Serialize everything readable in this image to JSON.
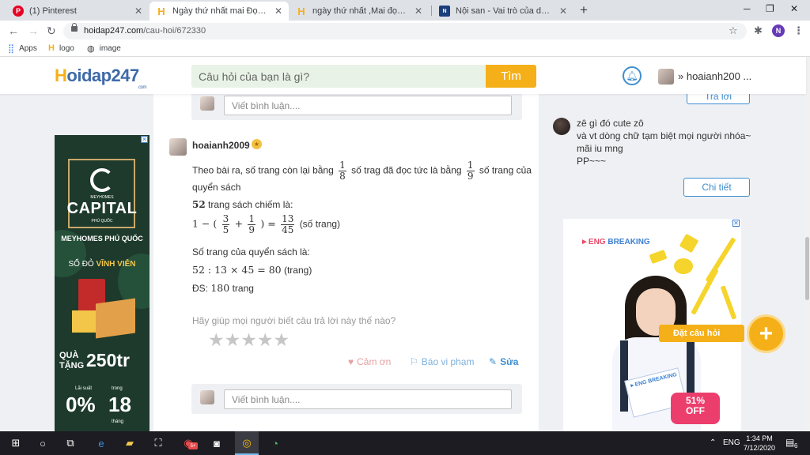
{
  "browser": {
    "tabs": [
      {
        "title": "(1) Pinterest",
        "icon": "pinterest-icon",
        "active": false
      },
      {
        "title": "Ngày thứ nhất mai Đọc được 3/5 số...",
        "icon": "hoidap-icon",
        "active": true
      },
      {
        "title": "ngày thứ nhất ,Mai đọc được 3/5 c...",
        "icon": "hoidap-icon",
        "active": false
      },
      {
        "title": "Nội san - Vai trò của dân ca trong...",
        "icon": "noisan-icon",
        "active": false
      }
    ],
    "url_host": "hoidap247.com",
    "url_path": "/cau-hoi/672330",
    "profile_initial": "N",
    "bookmarks": [
      {
        "label": "Apps",
        "icon": "apps-grid-icon"
      },
      {
        "label": "logo",
        "icon": "hoidap-icon"
      },
      {
        "label": "image",
        "icon": "globe-icon"
      }
    ]
  },
  "site": {
    "logo_h": "H",
    "logo_rest": "oidap247",
    "logo_sub": ".com",
    "search_placeholder": "Câu hỏi của bạn là gì?",
    "search_button": "Tìm",
    "user_name": "hoaianh200 ..."
  },
  "comment_placeholder": "Viết bình luận....",
  "answer": {
    "user": "hoaianh2009",
    "line1_a": "Theo bài ra, số trang còn lại bằng",
    "frac1_num": "1",
    "frac1_den": "8",
    "line1_b": "số trag đã đọc tức là bằng",
    "frac2_num": "1",
    "frac2_den": "9",
    "line1_c": "số trang của",
    "line2": "quyển sách",
    "line3_num": "52",
    "line3_text": "trang sách chiếm là:",
    "line4_a": "1 − (",
    "frac3_num": "3",
    "frac3_den": "5",
    "line4_plus": "+",
    "frac4_num": "1",
    "frac4_den": "9",
    "line4_eq": ") =",
    "frac5_num": "13",
    "frac5_den": "45",
    "line4_unit": "(số trang)",
    "line5": "Số trang của quyển sách là:",
    "line6_expr": "52 : 13 × 45 = 80",
    "line6_unit": "(trang)",
    "line7_label": "ĐS:",
    "line7_num": "180",
    "line7_unit": "trang",
    "help_text": "Hãy giúp mọi người biết câu trả lời này thế nào?",
    "rating": 0,
    "rating_max": 5,
    "thanks_label": "Cảm ơn",
    "report_label": "Báo vi phạm",
    "edit_label": "Sửa"
  },
  "sidebar": {
    "reply_button": "Trả lời",
    "message_lines": [
      "zê gì đó cute zô",
      "và vt dòng chữ tạm biệt mọi người nhóa~",
      "mãi iu mng",
      "PP~~~"
    ],
    "detail_button": "Chi tiết"
  },
  "ads": {
    "right": {
      "brand_prefix": "►ENG",
      "brand_highlight": "BREAKING",
      "book_brand": "►ENG BREAKING",
      "discount_pct": "51%",
      "discount_word": "OFF"
    },
    "left": {
      "top_brand": "MEYHOMES",
      "capital": "CAPITAL",
      "location_small": "PHÚ QUỐC",
      "headline": "MEYHOMES PHÚ QUỐC",
      "sub_a": "SỔ ĐỎ",
      "sub_b": "VĨNH VIỄN",
      "gift_a": "QUÀ",
      "gift_b": "TẶNG",
      "gift_amount": "250tr",
      "rate_label": "Lãi suất",
      "rate_value": "0%",
      "term_label": "trong",
      "term_value": "18",
      "term_unit": "tháng"
    }
  },
  "fab_label": "Đặt câu hỏi",
  "taskbar": {
    "lang": "ENG",
    "time": "1:34 PM",
    "date": "7/12/2020",
    "notif_count": "6",
    "badge": "5+"
  }
}
